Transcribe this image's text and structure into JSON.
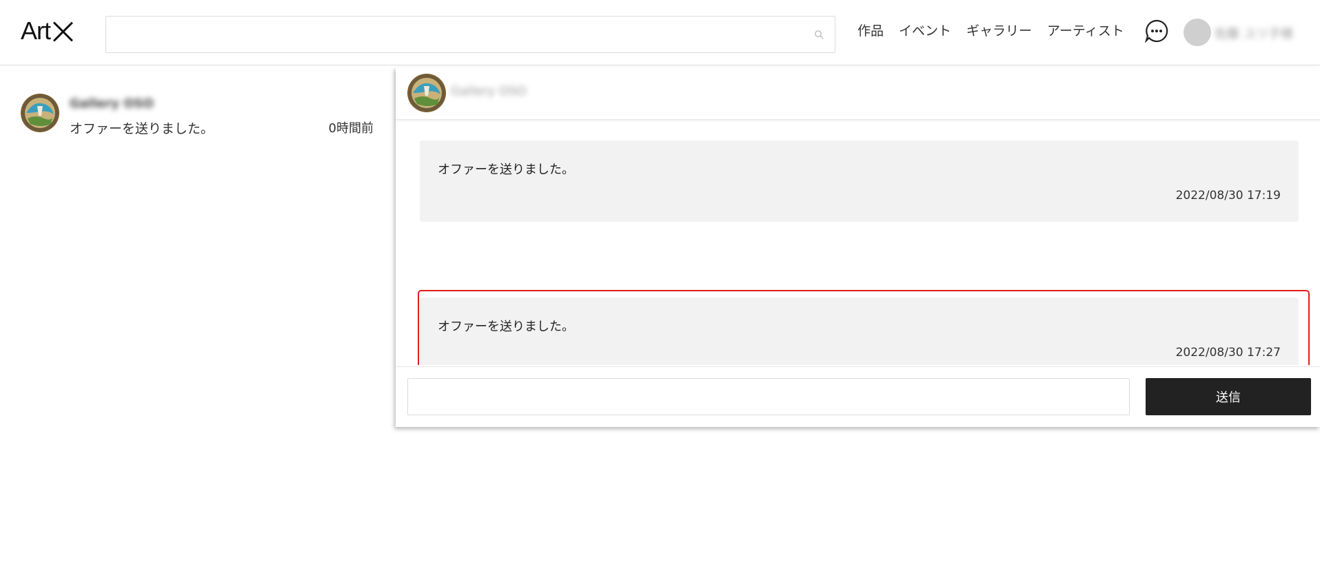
{
  "header": {
    "logo_text": "Art",
    "search_placeholder": "",
    "nav": [
      "作品",
      "イベント",
      "ギャラリー",
      "アーティスト"
    ],
    "user_name": "佐藤 ユリ子様"
  },
  "conversations": [
    {
      "name": "Gallery OSO",
      "last_message": "オファーを送りました。",
      "time": "0時間前"
    }
  ],
  "chat": {
    "title": "Gallery OSO",
    "messages": [
      {
        "text": "オファーを送りました。",
        "time": "2022/08/30 17:19"
      },
      {
        "text": "オファーを送りました。",
        "time": "2022/08/30 17:27"
      }
    ],
    "input_placeholder": "",
    "send_label": "送信"
  },
  "colors": {
    "highlight": "#e41b1b",
    "send_button": "#222222",
    "bubble": "#f2f2f2"
  }
}
